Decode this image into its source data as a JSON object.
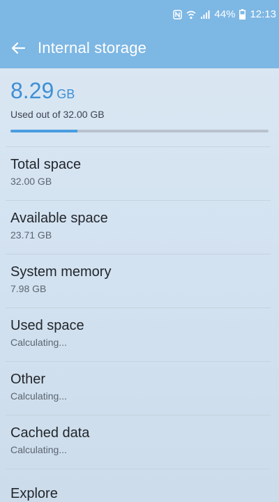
{
  "status_bar": {
    "battery": "44%",
    "time": "12:13",
    "icons": [
      "nfc-icon",
      "wifi-icon",
      "signal-icon",
      "battery-icon"
    ]
  },
  "app_bar": {
    "title": "Internal storage",
    "back_icon": "arrow-left-icon"
  },
  "summary": {
    "used_value": "8.29",
    "used_unit": "GB",
    "caption": "Used out of 32.00 GB",
    "used_fraction": 0.26
  },
  "items": [
    {
      "label": "Total space",
      "value": "32.00 GB"
    },
    {
      "label": "Available space",
      "value": "23.71 GB"
    },
    {
      "label": "System memory",
      "value": "7.98 GB"
    },
    {
      "label": "Used space",
      "value": "Calculating..."
    },
    {
      "label": "Other",
      "value": "Calculating..."
    },
    {
      "label": "Cached data",
      "value": "Calculating..."
    },
    {
      "label": "Explore"
    }
  ],
  "colors": {
    "app_bar": "#7db7e4",
    "accent": "#3f8fd4",
    "progress": "#4a9de0",
    "background": "#d8e6f2"
  }
}
